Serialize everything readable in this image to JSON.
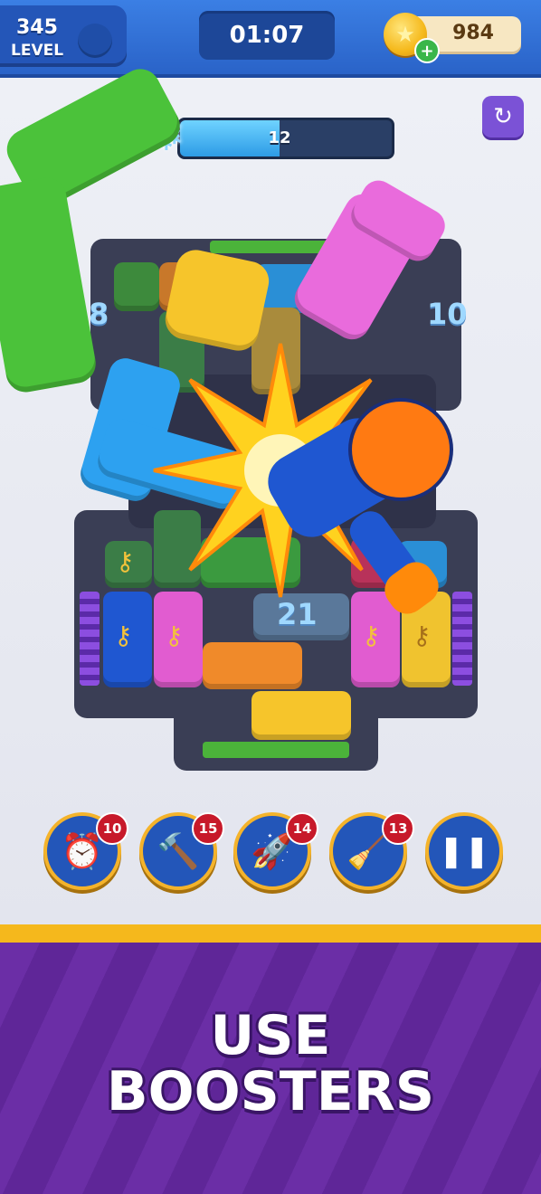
{
  "header": {
    "level_number": "345",
    "level_label": "LEVEL",
    "timer": "01:07",
    "coins": "984"
  },
  "freeze": {
    "value": "12",
    "fill_fraction": 0.47
  },
  "board": {
    "left_counter": "8",
    "right_counter": "10",
    "center_counter": "21"
  },
  "boosters": [
    {
      "name": "alarm-clock",
      "count": "10"
    },
    {
      "name": "hammer",
      "count": "15"
    },
    {
      "name": "rocket",
      "count": "14"
    },
    {
      "name": "vacuum",
      "count": "13"
    }
  ],
  "banner": {
    "line1": "USE",
    "line2": "BOOSTERS"
  },
  "colors": {
    "green": "#4bc23a",
    "pink": "#e15cd0",
    "blue": "#2da1f0",
    "yellow": "#f6c52b",
    "orange": "#f08a2a",
    "purple": "#7b52d6"
  }
}
